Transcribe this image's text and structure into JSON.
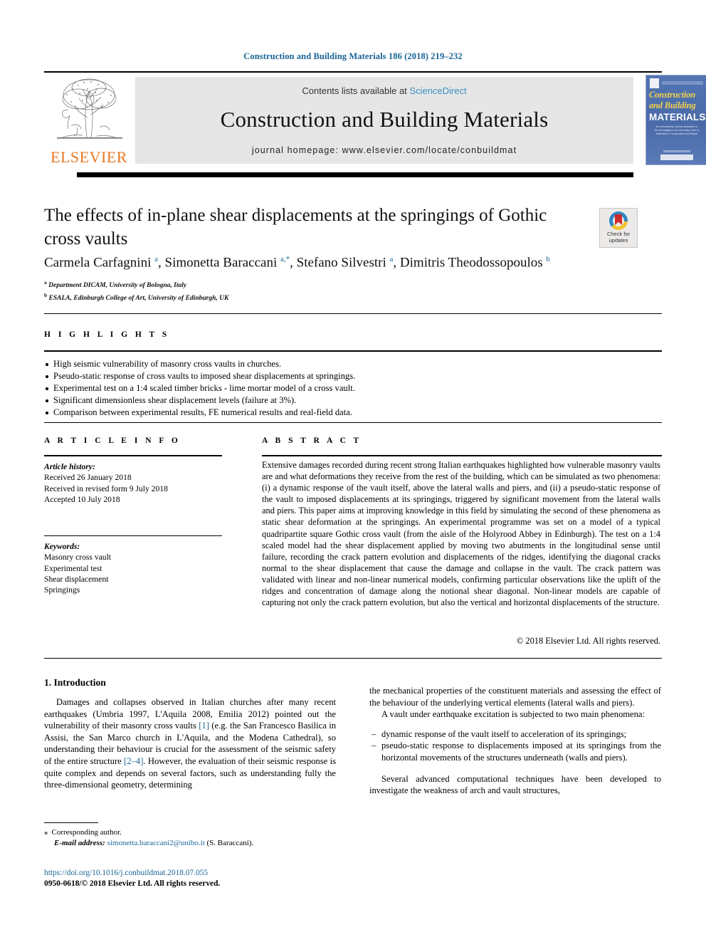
{
  "running_head": "Construction and Building Materials 186 (2018) 219–232",
  "masthead": {
    "contents_prefix": "Contents lists available at ",
    "sciencedirect": "ScienceDirect",
    "journal_title": "Construction and Building Materials",
    "homepage": "journal homepage: www.elsevier.com/locate/conbuildmat",
    "publisher_logo_text": "ELSEVIER",
    "cover": {
      "line1": "Construction",
      "line2": "and Building",
      "line3": "MATERIALS",
      "blurb": "An International Journal dedicated to the Investigation and Innovative Use of Materials in Construction and Repair"
    }
  },
  "article": {
    "title": "The effects of in-plane shear displacements at the springings of Gothic cross vaults",
    "authors_html": "Carmela Carfagnini <sup>a</sup>, Simonetta Baraccani <sup>a,*</sup>, Stefano Silvestri <sup>a</sup>, Dimitris Theodossopoulos <sup>b</sup>",
    "affiliation_a": "Department DICAM, University of Bologna, Italy",
    "affiliation_b": "ESALA, Edinburgh College of Art, University of Edinburgh, UK",
    "crossmark_label": "Check for updates"
  },
  "highlights": {
    "heading": "H I G H L I G H T S",
    "items": [
      "High seismic vulnerability of masonry cross vaults in churches.",
      "Pseudo-static response of cross vaults to imposed shear displacements at springings.",
      "Experimental test on a 1:4 scaled timber bricks - lime mortar model of a cross vault.",
      "Significant dimensionless shear displacement levels (failure at 3%).",
      "Comparison between experimental results, FE numerical results and real-field data."
    ]
  },
  "article_info": {
    "heading": "A R T I C L E    I N F O",
    "history_label": "Article history:",
    "history": [
      "Received 26 January 2018",
      "Received in revised form 9 July 2018",
      "Accepted 10 July 2018"
    ],
    "keywords_label": "Keywords:",
    "keywords": [
      "Masonry cross vault",
      "Experimental test",
      "Shear displacement",
      "Springings"
    ]
  },
  "abstract": {
    "heading": "A B S T R A C T",
    "text": "Extensive damages recorded during recent strong Italian earthquakes highlighted how vulnerable masonry vaults are and what deformations they receive from the rest of the building, which can be simulated as two phenomena: (i) a dynamic response of the vault itself, above the lateral walls and piers, and (ii) a pseudo-static response of the vault to imposed displacements at its springings, triggered by significant movement from the lateral walls and piers. This paper aims at improving knowledge in this field by simulating the second of these phenomena as static shear deformation at the springings. An experimental programme was set on a model of a typical quadripartite square Gothic cross vault (from the aisle of the Holyrood Abbey in Edinburgh). The test on a 1:4 scaled model had the shear displacement applied by moving two abutments in the longitudinal sense until failure, recording the crack pattern evolution and displacements of the ridges, identifying the diagonal cracks normal to the shear displacement that cause the damage and collapse in the vault. The crack pattern was validated with linear and non-linear numerical models, confirming particular observations like the uplift of the ridges and concentration of damage along the notional shear diagonal. Non-linear models are capable of capturing not only the crack pattern evolution, but also the vertical and horizontal displacements of the structure.",
    "copyright": "© 2018 Elsevier Ltd. All rights reserved."
  },
  "body": {
    "section_title": "1. Introduction",
    "left_para_1_a": "Damages and collapses observed in Italian churches after many recent earthquakes (Umbria 1997, L'Aquila 2008, Emilia 2012) pointed out the vulnerability of their masonry cross vaults ",
    "left_ref_1": "[1]",
    "left_para_1_b": " (e.g. the San Francesco Basilica in Assisi, the San Marco church in L'Aquila, and the Modena Cathedral), so understanding their behaviour is crucial for the assessment of the seismic safety of the entire structure ",
    "left_ref_2": "[2–4]",
    "left_para_1_c": ". However, the evaluation of their seismic response is quite complex and depends on several factors, such as understanding fully the three-dimensional geometry, determining",
    "right_para_1": "the mechanical properties of the constituent materials and assessing the effect of the behaviour of the underlying vertical elements (lateral walls and piers).",
    "right_para_2": "A vault under earthquake excitation is subjected to two main phenomena:",
    "right_bullets": [
      "dynamic response of the vault itself to acceleration of its springings;",
      "pseudo-static response to displacements imposed at its springings from the horizontal movements of the structures underneath (walls and piers)."
    ],
    "right_para_3": "Several advanced computational techniques have been developed to investigate the weakness of arch and vault structures,"
  },
  "footnote": {
    "star": "⁎",
    "corresponding": "Corresponding author.",
    "email_label": "E-mail address:",
    "email": "simonetta.baraccani2@unibo.it",
    "email_suffix": " (S. Baraccani)."
  },
  "footer": {
    "doi": "https://doi.org/10.1016/j.conbuildmat.2018.07.055",
    "issn_line": "0950-0618/© 2018 Elsevier Ltd. All rights reserved."
  },
  "colors": {
    "link": "#1a6496",
    "elsevier_orange": "#E87722",
    "sciencedirect": "#3a8fc0",
    "panel_grey": "#e6e6e6",
    "cover_blue": "#4a6fae",
    "cover_yellow": "#f2d24b"
  }
}
